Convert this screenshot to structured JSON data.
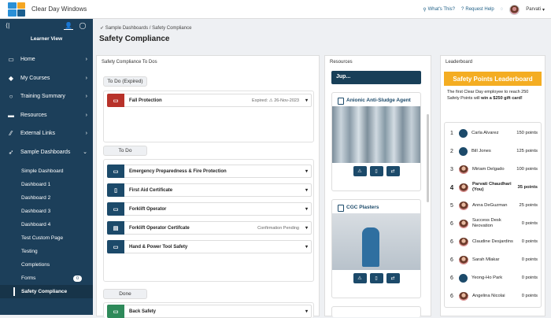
{
  "app": {
    "name": "Clear Day Windows"
  },
  "topbar": {
    "whats_this": "What's This?",
    "help": "Request Help",
    "user": "Parvati"
  },
  "sidebar": {
    "view_label": "Learner View",
    "items": [
      {
        "label": "Home",
        "icon": "monitor-icon"
      },
      {
        "label": "My Courses",
        "icon": "graduation-cap-icon"
      },
      {
        "label": "Training Summary",
        "icon": "circle-icon"
      },
      {
        "label": "Resources",
        "icon": "folder-icon"
      },
      {
        "label": "External Links",
        "icon": "road-icon"
      },
      {
        "label": "Sample Dashboards",
        "icon": "rocket-icon"
      }
    ],
    "subitems": [
      "Simple Dashboard",
      "Dashboard 1",
      "Dashboard 2",
      "Dashboard 3",
      "Dashboard 4",
      "Test Custom Page",
      "Testing",
      "Completions",
      "Forms",
      "Safety Compliance"
    ],
    "forms_badge": "0"
  },
  "breadcrumb": "Sample Dashboards / Safety Compliance",
  "page_title": "Safety Compliance",
  "todos": {
    "header": "Safety Compliance To Dos",
    "expired_label": "To Do (Expired)",
    "expired_items": [
      {
        "name": "Fall Protection",
        "meta": "Expired: ⚠ 26-Nov-2023"
      }
    ],
    "todo_label": "To Do",
    "todo_items": [
      {
        "name": "Emergency Preparedness & Fire Protection",
        "meta": ""
      },
      {
        "name": "First Aid Certificate",
        "meta": ""
      },
      {
        "name": "Forklift Operator",
        "meta": ""
      },
      {
        "name": "Forklift Operator Certifcate",
        "meta": "Confirmation Pending"
      },
      {
        "name": "Hand & Power Tool Safety",
        "meta": ""
      }
    ],
    "done_label": "Done",
    "done_items": [
      {
        "name": "Back Safety",
        "meta": ""
      }
    ]
  },
  "resources": {
    "header": "Resources",
    "selector": "Jup...",
    "cards": [
      {
        "title": "Anionic Anti-Sludge Agent"
      },
      {
        "title": "CGC Plasters"
      }
    ]
  },
  "leaderboard": {
    "header": "Leaderboard",
    "title": "Safety Points Leaderboard",
    "desc_pre": "The first Clear Day employee to reach 250 Safety Points will ",
    "desc_bold": "win a $250 gift card!",
    "rows": [
      {
        "rank": "1",
        "name": "Carla Alvarez",
        "points": "150 points",
        "photo": false,
        "bold": false
      },
      {
        "rank": "2",
        "name": "Bill Jones",
        "points": "125 points",
        "photo": false,
        "bold": false
      },
      {
        "rank": "3",
        "name": "Miriam Delgado",
        "points": "100 points",
        "photo": true,
        "bold": false
      },
      {
        "rank": "4",
        "name": "Parvati Chaudhari (You)",
        "points": "35 points",
        "photo": true,
        "bold": true
      },
      {
        "rank": "5",
        "name": "Anna DeGuzman",
        "points": "25 points",
        "photo": true,
        "bold": false
      },
      {
        "rank": "6",
        "name": "Success Desk Neovation",
        "points": "0 points",
        "photo": true,
        "bold": false
      },
      {
        "rank": "6",
        "name": "Claudine Desjardins",
        "points": "0 points",
        "photo": true,
        "bold": false
      },
      {
        "rank": "6",
        "name": "Sarah Mlakar",
        "points": "0 points",
        "photo": true,
        "bold": false
      },
      {
        "rank": "6",
        "name": "Yeong-Ho Park",
        "points": "0 points",
        "photo": false,
        "bold": false
      },
      {
        "rank": "6",
        "name": "Angelina Nicolai",
        "points": "0 points",
        "photo": true,
        "bold": false
      }
    ]
  },
  "colors": {
    "sidebar": "#1c3f5a",
    "accent": "#f4ad22",
    "expired": "#b8322a",
    "done": "#2e8a5a"
  }
}
